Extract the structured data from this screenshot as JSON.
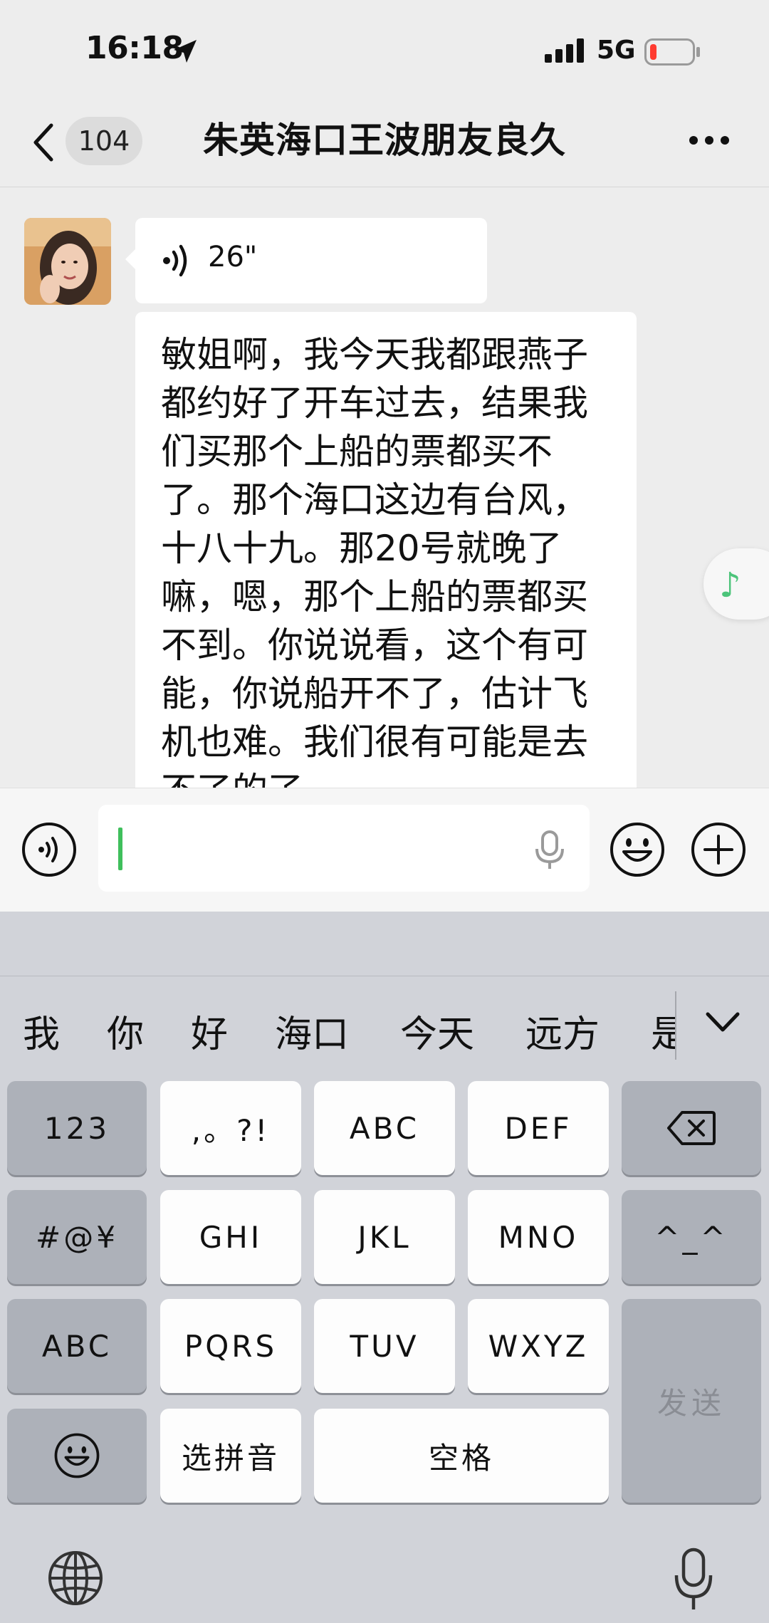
{
  "status_bar": {
    "time": "16:18",
    "network": "5G",
    "battery_color": "#ff3b30"
  },
  "nav": {
    "unread_count": "104",
    "title": "朱英海口王波朋友良久"
  },
  "messages": {
    "voice": {
      "duration": "26\""
    },
    "text": "敏姐啊，我今天我都跟燕子都约好了开车过去，结果我们买那个上船的票都买不了。那个海口这边有台风，十八十九。那20号就晚了嘛，嗯，那个上船的票都买不到。你说说看，这个有可能，你说船开不了，估计飞机也难。我们很有可能是去不了的了。"
  },
  "input": {
    "value": ""
  },
  "keyboard": {
    "candidates": [
      "我",
      "你",
      "好",
      "海口",
      "今天",
      "远方",
      "是"
    ],
    "keys": {
      "numbers": "123",
      "punct": ",。?!",
      "abc_top": "ABC",
      "def": "DEF",
      "symbols": "#@¥",
      "ghi": "GHI",
      "jkl": "JKL",
      "mno": "MNO",
      "kaomoji": "^_^",
      "abc_switch": "ABC",
      "pqrs": "PQRS",
      "tuv": "TUV",
      "wxyz": "WXYZ",
      "select_pinyin": "选拼音",
      "space": "空格",
      "send": "发送"
    }
  },
  "colors": {
    "accent_green": "#07c160",
    "keyboard_bg": "#d1d3d9",
    "chat_bg": "#ededed"
  }
}
